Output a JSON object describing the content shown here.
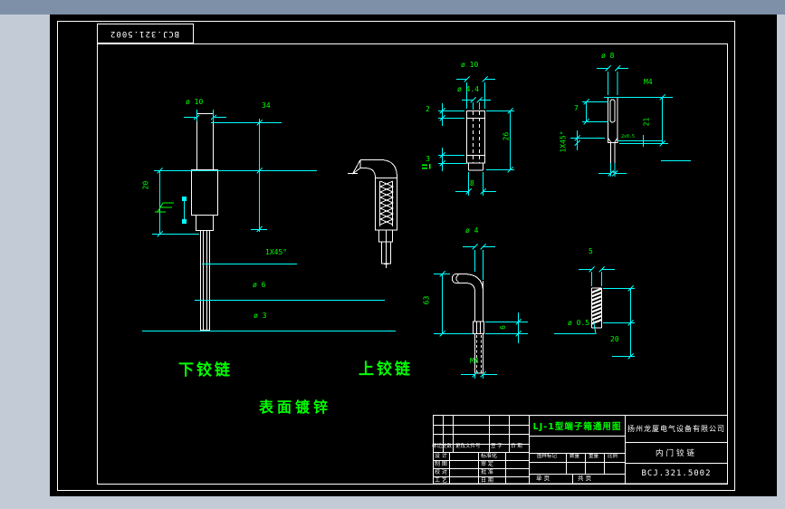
{
  "colors": {
    "surround": "#c3cbd7",
    "topbar": "#7e90a8",
    "canvas": "#000000",
    "outline_white": "#ffffff",
    "dimension_cyan": "#00ffff",
    "text_green": "#00ff00"
  },
  "stamp": {
    "text": "BCJ.321.5002"
  },
  "labels": {
    "lower_hinge": "下铰链",
    "upper_hinge": "上铰链",
    "finish_note": "表面镀锌"
  },
  "dims": {
    "f1": {
      "d10": "ø 10",
      "l34": "34",
      "l20": "20",
      "chamfer": "1X45°",
      "d6": "ø 6",
      "d3": "ø 3"
    },
    "f3": {
      "d10": "ø 10",
      "d44": "ø 4.4",
      "t2": "2",
      "t3": "3",
      "h26": "26",
      "w8": "8"
    },
    "f4": {
      "d8": "ø 8",
      "m4": "M4",
      "t7": "7",
      "h21": "21",
      "chamfer": "1X45°",
      "groove": "2x0.5"
    },
    "f5": {
      "d4": "ø 4",
      "h63": "63",
      "h6": "6",
      "m4": "M4"
    },
    "f6": {
      "w5": "5",
      "d05": "ø 0.5",
      "h20": "20"
    }
  },
  "titleblock": {
    "drawing_title": "LJ-1型端子箱通用图",
    "company": "扬州龙厦电气设备有限公司",
    "part_name": "内门铰链",
    "drawing_no": "BCJ.321.5002",
    "rev_headers": [
      "标记处数",
      "更改文件号",
      "签 字",
      "日 期"
    ],
    "roles_left": [
      "设 计",
      "制 图",
      "校 对",
      "工 艺"
    ],
    "roles_right": [
      "标准化",
      "审 定",
      "批 准",
      "日 期"
    ],
    "spec_headers": [
      "图样标记",
      "数量",
      "重量",
      "比例"
    ],
    "page_single": "单 页",
    "page_total": "共 页"
  }
}
